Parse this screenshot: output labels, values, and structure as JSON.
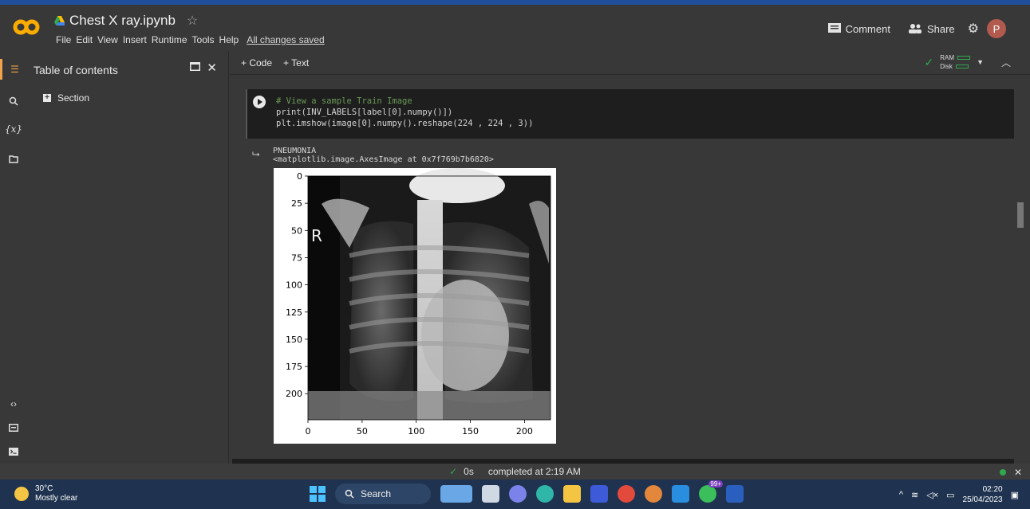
{
  "header": {
    "doc_title": "Chest X ray.ipynb",
    "menus": [
      "File",
      "Edit",
      "View",
      "Insert",
      "Runtime",
      "Tools",
      "Help"
    ],
    "save_status": "All changes saved",
    "comment_label": "Comment",
    "share_label": "Share",
    "avatar_letter": "P"
  },
  "sidebar": {
    "title": "Table of contents",
    "section_label": "Section",
    "rail_icons": [
      "toc-icon",
      "search-icon",
      "variables-icon",
      "folder-icon",
      "code-snippets-icon",
      "command-palette-icon",
      "terminal-icon"
    ],
    "variables_label": "{x}"
  },
  "toolbar": {
    "add_code": "+ Code",
    "add_text": "+ Text",
    "ram_label": "RAM",
    "disk_label": "Disk"
  },
  "cell": {
    "line1": "# View a sample Train Image",
    "line2": "print(INV_LABELS[label[0].numpy()])",
    "line3": "plt.imshow(image[0].numpy().reshape(224 , 224 , 3))"
  },
  "output": {
    "line1": "PNEUMONIA",
    "line2": "<matplotlib.image.AxesImage at 0x7f769b7b6820>",
    "marker": "R"
  },
  "chart_data": {
    "type": "heatmap",
    "title": "",
    "xlabel": "",
    "ylabel": "",
    "xticks": [
      0,
      50,
      100,
      150,
      200
    ],
    "yticks": [
      0,
      25,
      50,
      75,
      100,
      125,
      150,
      175,
      200
    ],
    "xlim": [
      0,
      224
    ],
    "ylim": [
      224,
      0
    ],
    "image_size": [
      224,
      224
    ]
  },
  "status": {
    "time": "0s",
    "message": "completed at 2:19 AM"
  },
  "taskbar": {
    "temperature": "30°C",
    "weather": "Mostly clear",
    "search_label": "Search",
    "clock_time": "02:20",
    "clock_date": "25/04/2023",
    "badge": "99+"
  },
  "colors": {
    "accent": "#f0a34a",
    "background": "#383838",
    "code_bg": "#1e1e1e",
    "comment_green": "#6a9955",
    "taskbar": "#1f3350"
  }
}
